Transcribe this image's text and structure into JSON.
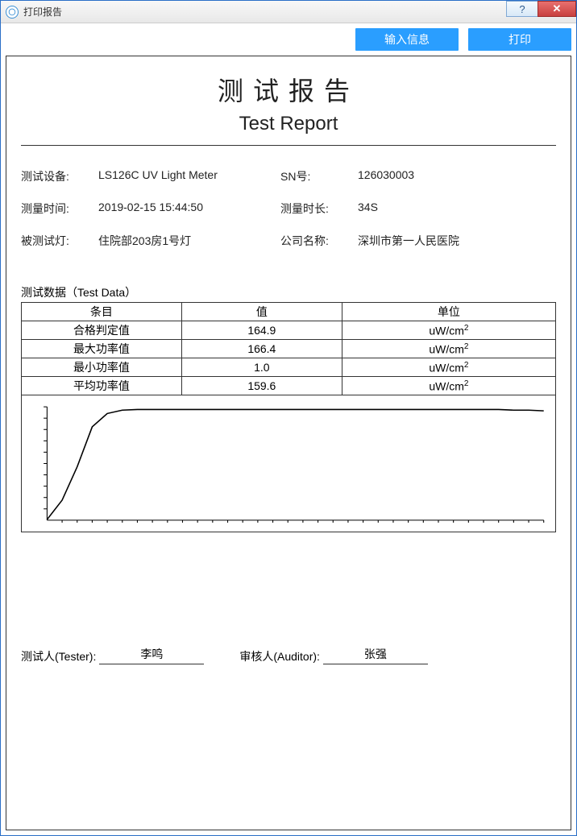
{
  "window": {
    "title": "打印报告"
  },
  "toolbar": {
    "input_label": "输入信息",
    "print_label": "打印"
  },
  "report": {
    "title_cn": "测试报告",
    "title_en": "Test Report",
    "meta": {
      "device_label": "测试设备:",
      "device": "LS126C UV Light Meter",
      "sn_label": "SN号:",
      "sn": "126030003",
      "time_label": "测量时间:",
      "time": "2019-02-15 15:44:50",
      "duration_label": "测量时长:",
      "duration": "34S",
      "lamp_label": "被测试灯:",
      "lamp": "住院部203房1号灯",
      "company_label": "公司名称:",
      "company": "深圳市第一人民医院"
    },
    "data_section_label": "测试数据（Test Data）",
    "table": {
      "headers": {
        "item": "条目",
        "value": "值",
        "unit": "单位"
      },
      "rows": [
        {
          "item": "合格判定值",
          "value": "164.9",
          "unit_base": "uW/cm",
          "unit_exp": "2"
        },
        {
          "item": "最大功率值",
          "value": "166.4",
          "unit_base": "uW/cm",
          "unit_exp": "2"
        },
        {
          "item": "最小功率值",
          "value": "1.0",
          "unit_base": "uW/cm",
          "unit_exp": "2"
        },
        {
          "item": "平均功率值",
          "value": "159.6",
          "unit_base": "uW/cm",
          "unit_exp": "2"
        }
      ]
    },
    "signatures": {
      "tester_label": "测试人(Tester):",
      "tester": "李鸣",
      "auditor_label": "审核人(Auditor):",
      "auditor": "张强"
    }
  },
  "chart_data": {
    "type": "line",
    "title": "",
    "xlabel": "",
    "ylabel": "",
    "x": [
      0,
      1,
      2,
      3,
      4,
      5,
      6,
      7,
      8,
      9,
      10,
      11,
      12,
      13,
      14,
      15,
      16,
      17,
      18,
      19,
      20,
      21,
      22,
      23,
      24,
      25,
      26,
      27,
      28,
      29,
      30,
      31,
      32,
      33
    ],
    "values": [
      1,
      30,
      80,
      140,
      160,
      165,
      166,
      166,
      166,
      166,
      166,
      166,
      166,
      166,
      166,
      166,
      166,
      166,
      166,
      166,
      166,
      166,
      166,
      166,
      166,
      166,
      166,
      166,
      166,
      166,
      166,
      165,
      165,
      164
    ],
    "ylim": [
      0,
      170
    ],
    "xlim": [
      0,
      33
    ]
  }
}
